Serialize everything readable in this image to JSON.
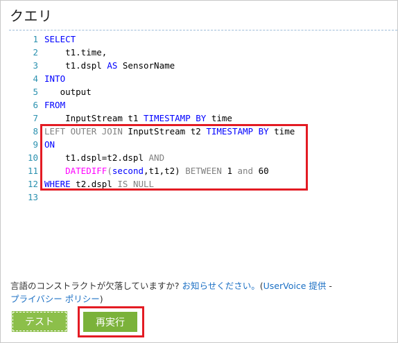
{
  "title": "クエリ",
  "editor": {
    "lines": [
      {
        "n": "1",
        "tokens": [
          {
            "t": "SELECT",
            "c": "kw"
          }
        ]
      },
      {
        "n": "2",
        "tokens": [
          {
            "t": "    t1.time,",
            "c": ""
          }
        ]
      },
      {
        "n": "3",
        "tokens": [
          {
            "t": "    t1.dspl ",
            "c": ""
          },
          {
            "t": "AS",
            "c": "kw"
          },
          {
            "t": " SensorName",
            "c": ""
          }
        ]
      },
      {
        "n": "4",
        "tokens": [
          {
            "t": "INTO",
            "c": "kw"
          }
        ]
      },
      {
        "n": "5",
        "tokens": [
          {
            "t": "   output",
            "c": ""
          }
        ]
      },
      {
        "n": "6",
        "tokens": [
          {
            "t": "FROM",
            "c": "kw"
          }
        ]
      },
      {
        "n": "7",
        "tokens": [
          {
            "t": "    InputStream t1 ",
            "c": ""
          },
          {
            "t": "TIMESTAMP BY",
            "c": "kw"
          },
          {
            "t": " time",
            "c": ""
          }
        ]
      },
      {
        "n": "8",
        "tokens": [
          {
            "t": "LEFT OUTER JOIN",
            "c": "gr"
          },
          {
            "t": " InputStream t2 ",
            "c": ""
          },
          {
            "t": "TIMESTAMP BY",
            "c": "kw"
          },
          {
            "t": " time",
            "c": ""
          }
        ]
      },
      {
        "n": "9",
        "tokens": [
          {
            "t": "ON",
            "c": "kw"
          }
        ]
      },
      {
        "n": "10",
        "tokens": [
          {
            "t": "    t1.dspl=t2.dspl ",
            "c": ""
          },
          {
            "t": "AND",
            "c": "gr"
          }
        ]
      },
      {
        "n": "11",
        "tokens": [
          {
            "t": "    ",
            "c": ""
          },
          {
            "t": "DATEDIFF",
            "c": "mg"
          },
          {
            "t": "(",
            "c": "gr"
          },
          {
            "t": "second",
            "c": "kw"
          },
          {
            "t": ",t1,t2) ",
            "c": ""
          },
          {
            "t": "BETWEEN",
            "c": "gr"
          },
          {
            "t": " 1 ",
            "c": ""
          },
          {
            "t": "and",
            "c": "gr"
          },
          {
            "t": " 60",
            "c": ""
          }
        ]
      },
      {
        "n": "12",
        "tokens": [
          {
            "t": "WHERE",
            "c": "kw"
          },
          {
            "t": " t2.dspl ",
            "c": ""
          },
          {
            "t": "IS NULL",
            "c": "gr"
          }
        ]
      },
      {
        "n": "13",
        "tokens": []
      }
    ]
  },
  "help": {
    "prefix": "言語のコンストラクトが欠落していますか? ",
    "link_feedback": "お知らせください。",
    "paren_open": "(",
    "link_uservoice": "UserVoice 提供",
    "dash": " -",
    "link_privacy": "プライバシー ポリシー",
    "paren_close": ")"
  },
  "buttons": {
    "test_label": "テスト",
    "rerun_label": "再実行"
  },
  "colors": {
    "keyword": "#0000ff",
    "gray": "#808080",
    "function": "#ff00ff",
    "line_number": "#2b91af",
    "highlight": "#e31b23",
    "button_green": "#7bb23a",
    "link": "#1a6fc4"
  }
}
